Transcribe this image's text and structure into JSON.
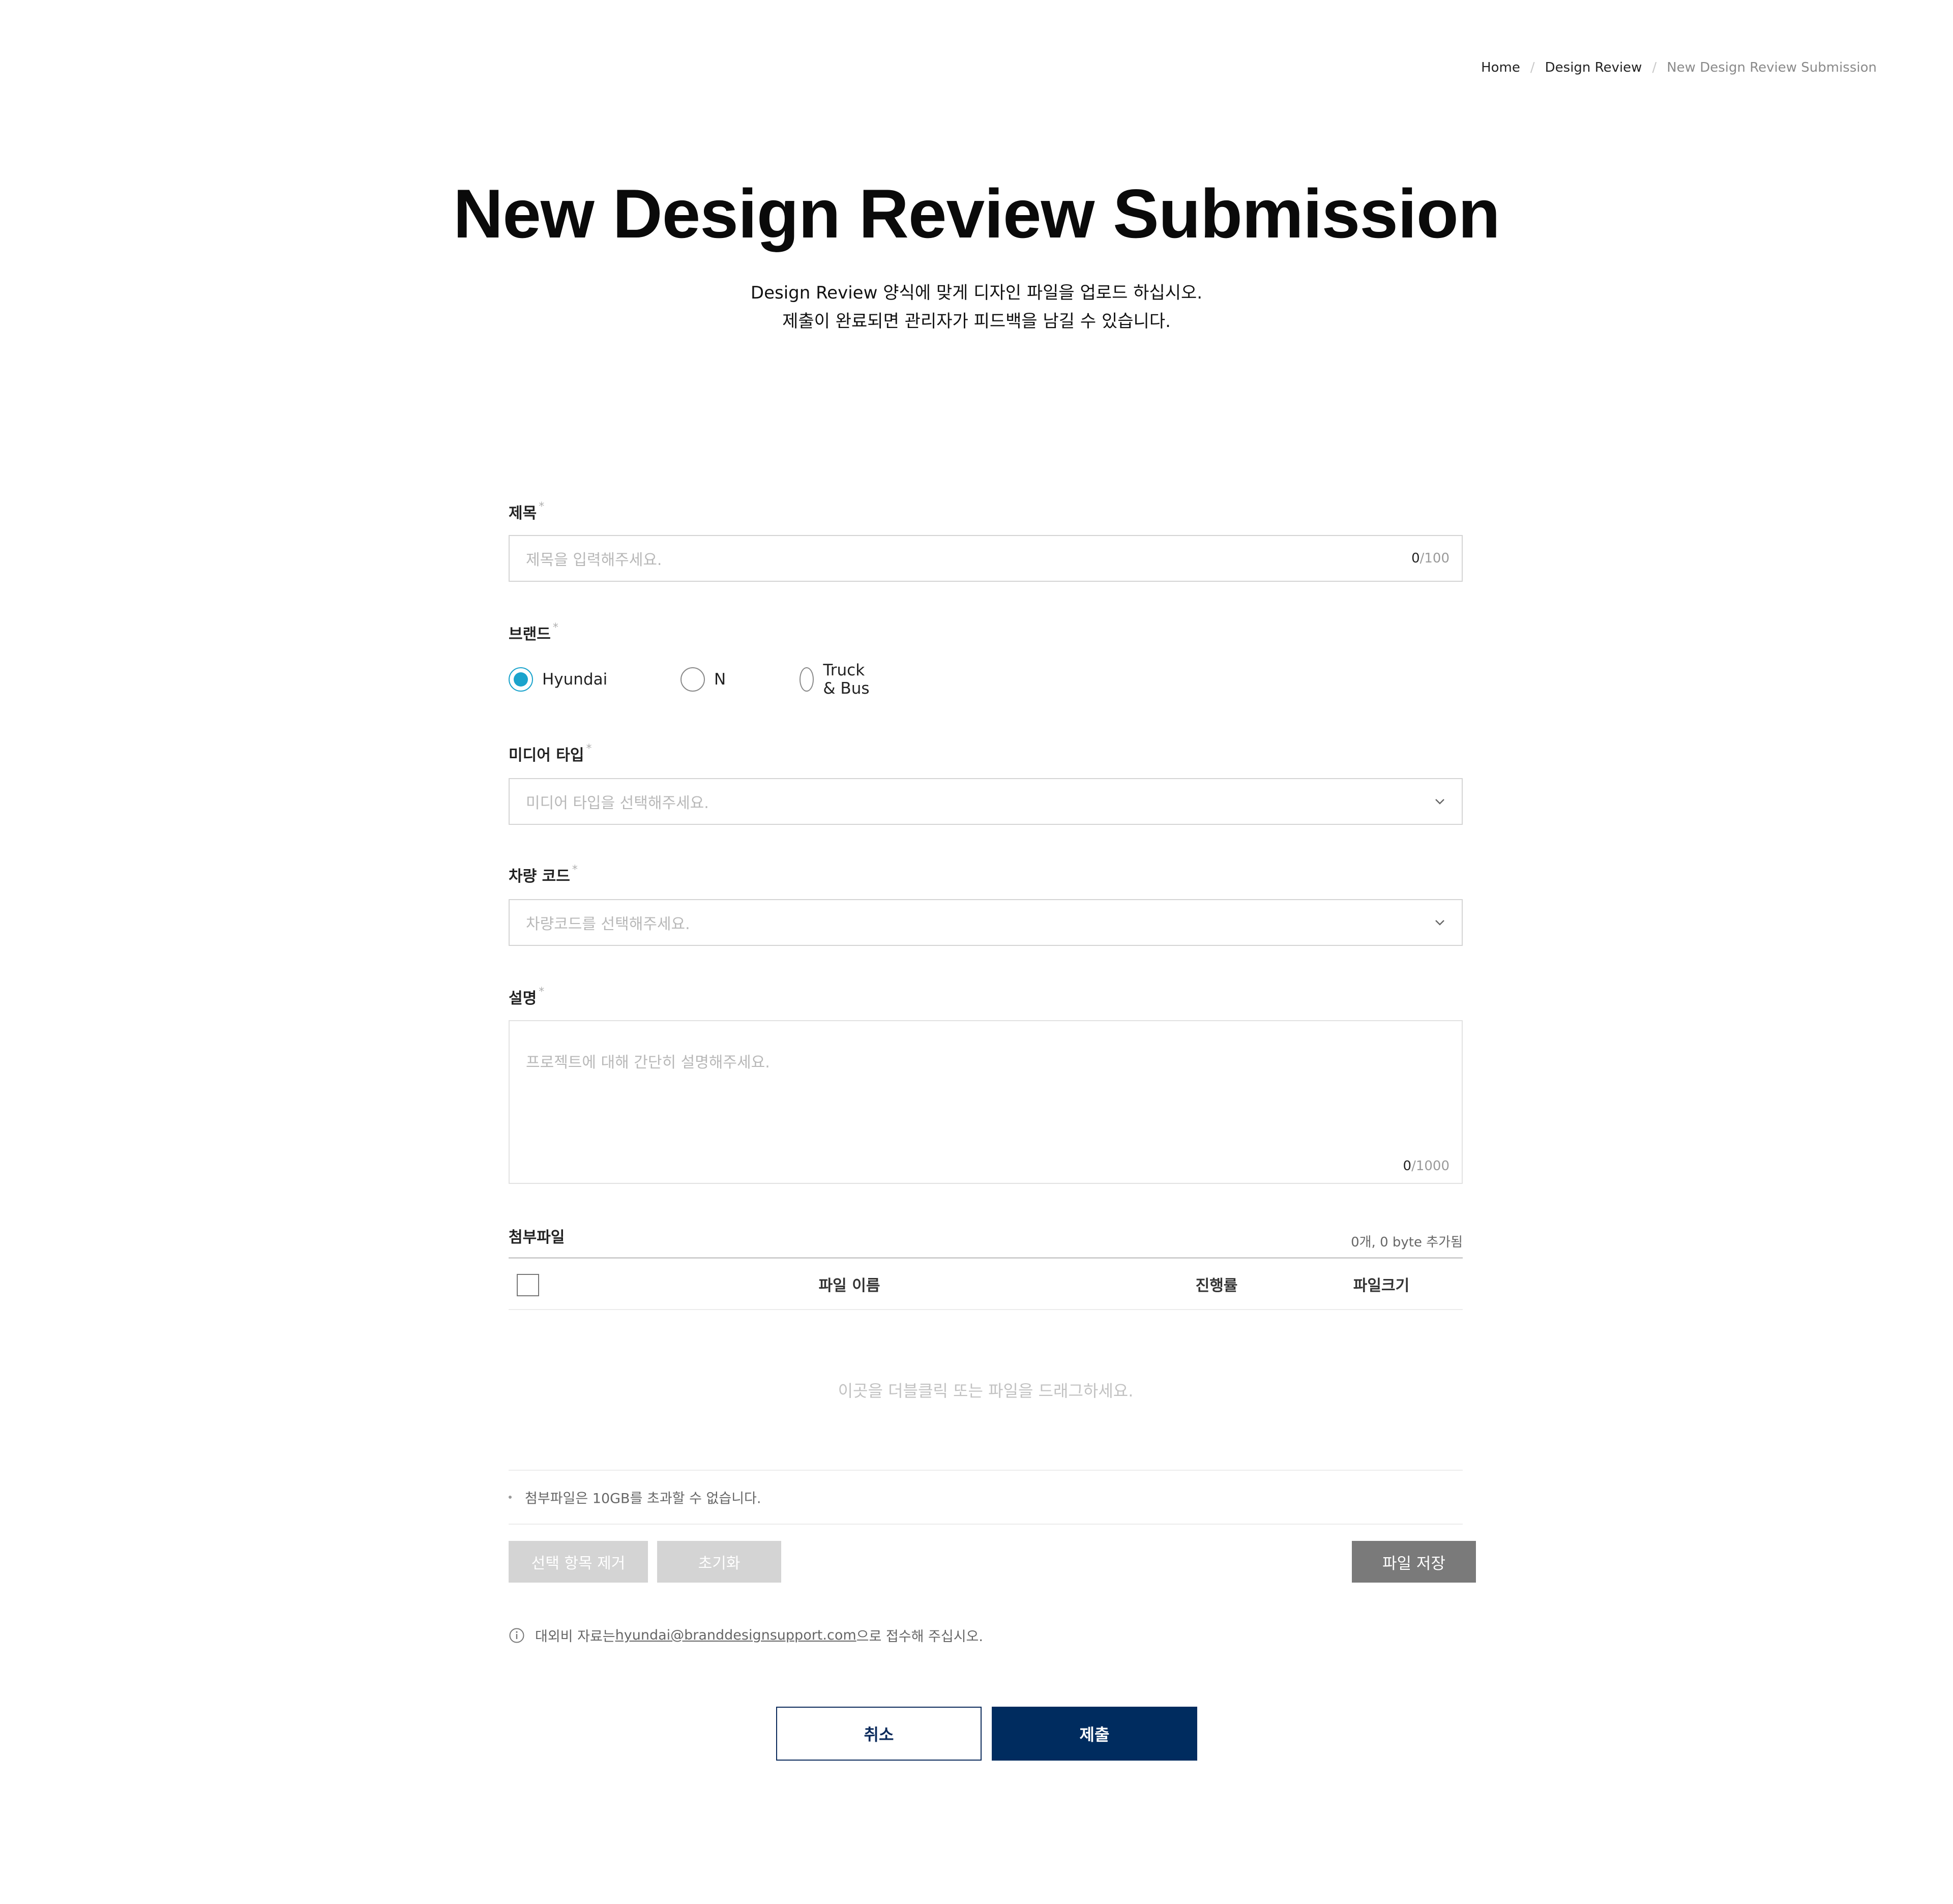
{
  "breadcrumb": {
    "items": [
      "Home",
      "Design Review",
      "New Design Review Submission"
    ],
    "separator": "/"
  },
  "header": {
    "title": "New Design Review Submission",
    "description_line1": "Design Review 양식에 맞게 디자인 파일을 업로드 하십시오.",
    "description_line2": "제출이 완료되면 관리자가 피드백을 남길 수 있습니다."
  },
  "form": {
    "required_mark": "*",
    "title_field": {
      "label": "제목",
      "placeholder": "제목을 입력해주세요.",
      "count_current": "0",
      "count_max": "/100"
    },
    "brand_field": {
      "label": "브랜드",
      "options": [
        "Hyundai",
        "N",
        "Truck & Bus"
      ],
      "selected": "Hyundai"
    },
    "media_type_field": {
      "label": "미디어 타입",
      "placeholder": "미디어 타입을 선택해주세요."
    },
    "vehicle_code_field": {
      "label": "차량 코드",
      "placeholder": "차량코드를 선택해주세요."
    },
    "description_field": {
      "label": "설명",
      "placeholder": "프로젝트에 대해 간단히 설명해주세요.",
      "count_current": "0",
      "count_max": "/1000"
    }
  },
  "attachments": {
    "label": "첨부파일",
    "summary": "0개, 0 byte 추가됨",
    "columns": [
      "파일 이름",
      "진행률",
      "파일크기"
    ],
    "dropzone_hint": "이곳을 더블클릭 또는 파일을 드래그하세요.",
    "notice": "첨부파일은 10GB를 초과할 수 없습니다.",
    "remove_selected_label": "선택 항목 제거",
    "reset_label": "초기화",
    "save_label": "파일 저장"
  },
  "info": {
    "text_before": "대외비 자료는 ",
    "email": "hyundai@branddesignsupport.com",
    "text_after": "으로 접수해 주십시오."
  },
  "actions": {
    "cancel_label": "취소",
    "submit_label": "제출"
  },
  "colors": {
    "accent_radio": "#1aa3cc",
    "primary_navy": "#002c5f",
    "disabled_gray": "#d4d4d4",
    "save_gray": "#7a7a7a"
  },
  "icons": [
    "chevron-down-icon",
    "info-icon"
  ]
}
